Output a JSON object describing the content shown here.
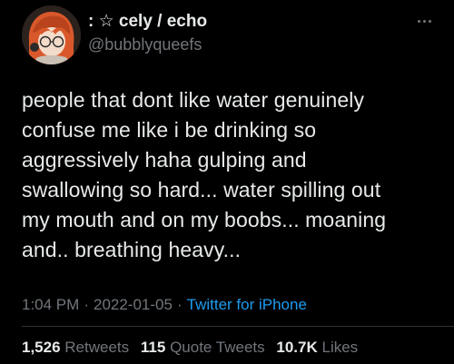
{
  "tweet": {
    "author": {
      "display_name": ": ☆ cely / echo",
      "handle": "@bubblyqueefs"
    },
    "more_icon": "more-horizontal-icon",
    "text_lines": [
      "people that dont like water genuinely",
      "confuse me like i be drinking so",
      "aggressively haha gulping and",
      "swallowing so hard... water spilling out",
      "my mouth and on my boobs... moaning",
      "and.. breathing heavy..."
    ],
    "time": "1:04 PM",
    "date": "2022-01-05",
    "separator": "·",
    "source": "Twitter for iPhone",
    "stats": {
      "retweets_count": "1,526",
      "retweets_label": "Retweets",
      "quotes_count": "115",
      "quotes_label": "Quote Tweets",
      "likes_count": "10.7K",
      "likes_label": "Likes"
    }
  },
  "colors": {
    "background": "#000000",
    "primary_text": "#e7e9ea",
    "secondary_text": "#71767b",
    "link": "#1d9bf0",
    "divider": "#2f3336"
  }
}
